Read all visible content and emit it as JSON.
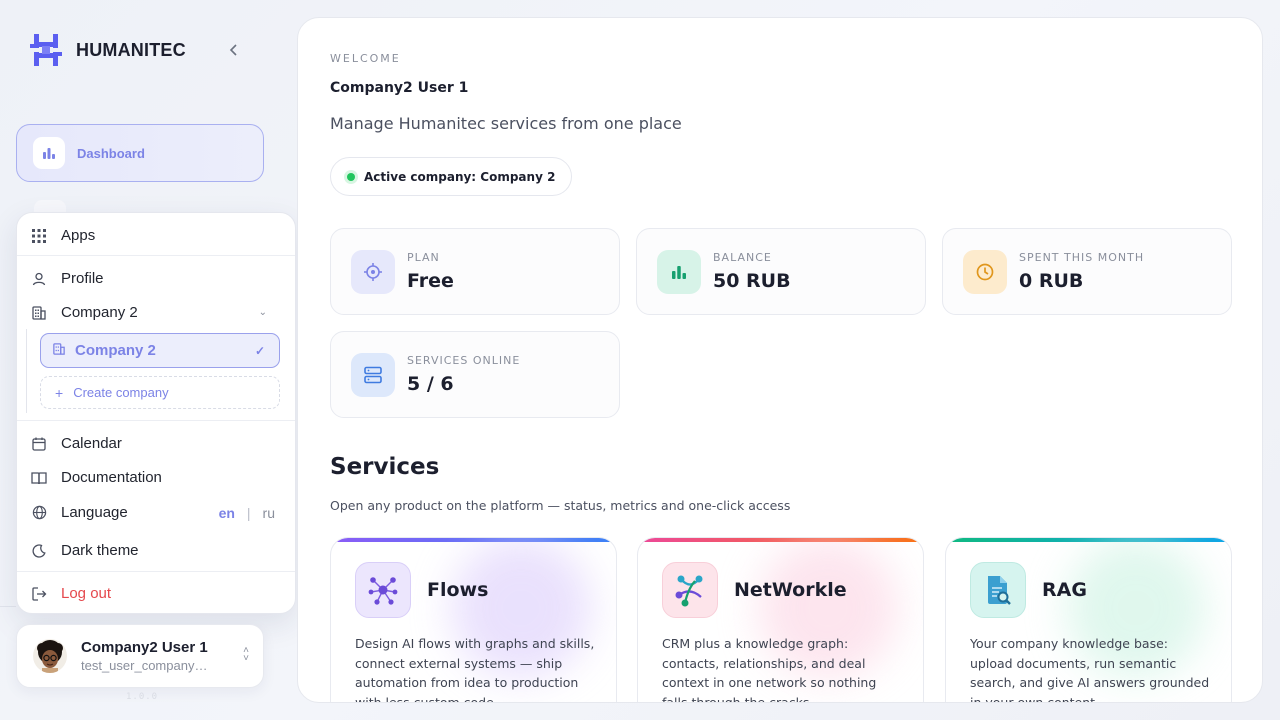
{
  "brand": {
    "name": "HUMANITEC"
  },
  "sidebar": {
    "dashboard_label": "Dashboard",
    "version": "1.0.0"
  },
  "menu": {
    "apps": "Apps",
    "profile": "Profile",
    "company": "Company 2",
    "company_selected": "Company 2",
    "create_company": "Create company",
    "calendar": "Calendar",
    "documentation": "Documentation",
    "language": "Language",
    "lang_en": "en",
    "lang_ru": "ru",
    "dark_theme": "Dark theme",
    "logout": "Log out"
  },
  "user": {
    "name": "Company2 User 1",
    "email": "test_user_company…"
  },
  "main": {
    "welcome": "WELCOME",
    "user": "Company2 User 1",
    "tagline": "Manage Humanitec services from one place",
    "active_company": "Active company: Company 2",
    "stats": [
      {
        "label": "PLAN",
        "value": "Free"
      },
      {
        "label": "BALANCE",
        "value": "50 RUB"
      },
      {
        "label": "SPENT THIS MONTH",
        "value": "0 RUB"
      },
      {
        "label": "SERVICES ONLINE",
        "value": "5 / 6"
      }
    ],
    "services_title": "Services",
    "services_sub": "Open any product on the platform — status, metrics and one-click access",
    "services": [
      {
        "name": "Flows",
        "desc": "Design AI flows with graphs and skills, connect external systems — ship automation from idea to production with less custom code."
      },
      {
        "name": "NetWorkle",
        "desc": "CRM plus a knowledge graph: contacts, relationships, and deal context in one network so nothing falls through the cracks."
      },
      {
        "name": "RAG",
        "desc": "Your company knowledge base: upload documents, run semantic search, and give AI answers grounded in your own content."
      }
    ]
  },
  "colors": {
    "accent": "#7c83e6",
    "danger": "#e5484d",
    "online": "#22c55e"
  }
}
